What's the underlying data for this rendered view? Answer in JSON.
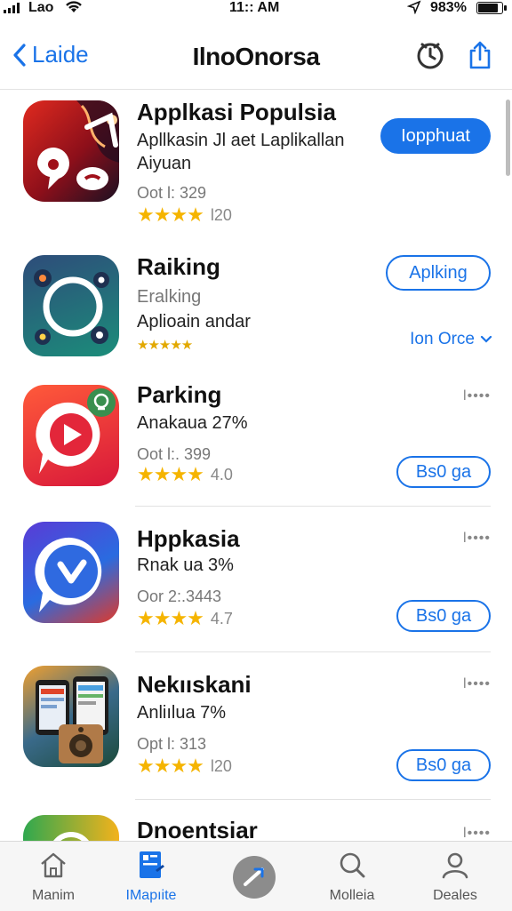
{
  "status": {
    "carrier": "Lao",
    "time": "11:: AM",
    "battery": "983%"
  },
  "nav": {
    "back_label": "Laide",
    "title": "IlnoOnorsa"
  },
  "apps": [
    {
      "name": "Applkasi  Populsia",
      "line1": "Apllkasin  Jl  aet  Laplikallan",
      "line2": "Aiyuan",
      "meta": "Oot  l:  329",
      "stars": "★★★★",
      "reviews": "l20",
      "button": "Iopphuat"
    },
    {
      "name": "Raiking",
      "line1": "Eralking",
      "line2": "Aplioain andar",
      "stars": "★★★★★",
      "button": "Aplking",
      "link": "Ion Orce"
    },
    {
      "name": "Parking",
      "line1": "Anakaua  27%",
      "meta": "Oot  l:.  399",
      "stars": "★★★★",
      "reviews": "4.0",
      "button": "Bs0 ga"
    },
    {
      "name": "Hppkasia",
      "line1": "Rnak ua  3%",
      "meta": "Oor  2:.3443",
      "stars": "★★★★",
      "reviews": "4.7",
      "button": "Bs0 ga"
    },
    {
      "name": "Nekııskani",
      "line1": "Anliılua  7%",
      "meta": "Opt  l:  313",
      "stars": "★★★★",
      "reviews": "l20",
      "button": "Bs0 ga"
    },
    {
      "name": "Dnoentsiar"
    }
  ],
  "more_dots": "l••••",
  "tabs": [
    {
      "label": "Manim",
      "icon": "home-icon"
    },
    {
      "label": "IMapıite",
      "icon": "apps-icon"
    },
    {
      "label": "",
      "icon": "compose-icon"
    },
    {
      "label": "Molleia",
      "icon": "search-icon"
    },
    {
      "label": "Deales",
      "icon": "profile-icon"
    }
  ],
  "colors": {
    "accent": "#1a73e8",
    "star": "#f5b400"
  }
}
